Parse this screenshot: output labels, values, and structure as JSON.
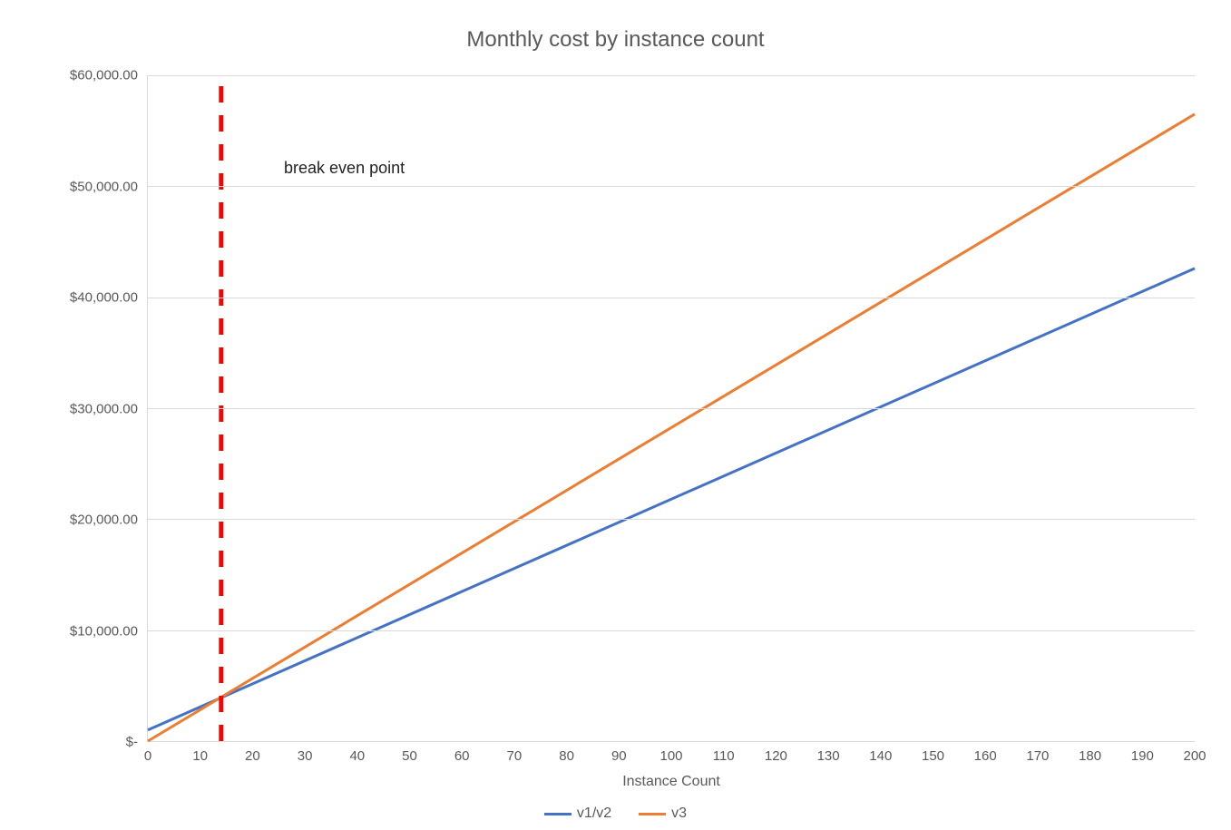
{
  "chart_data": {
    "type": "line",
    "title": "Monthly cost by instance count",
    "xlabel": "Instance Count",
    "ylabel": "",
    "xlim": [
      0,
      200
    ],
    "ylim": [
      0,
      60000
    ],
    "x_ticks": [
      0,
      10,
      20,
      30,
      40,
      50,
      60,
      70,
      80,
      90,
      100,
      110,
      120,
      130,
      140,
      150,
      160,
      170,
      180,
      190,
      200
    ],
    "y_ticks": [
      0,
      10000,
      20000,
      30000,
      40000,
      50000,
      60000
    ],
    "y_tick_labels": [
      " $-  ",
      " $10,000.00 ",
      " $20,000.00 ",
      " $30,000.00 ",
      " $40,000.00 ",
      " $50,000.00 ",
      " $60,000.00 "
    ],
    "series": [
      {
        "name": "v1/v2",
        "color": "#4472C4",
        "x": [
          0,
          200
        ],
        "y": [
          1000,
          42600
        ]
      },
      {
        "name": "v3",
        "color": "#ED7D31",
        "x": [
          0,
          200
        ],
        "y": [
          0,
          56500
        ]
      }
    ],
    "reference_line": {
      "x": 14,
      "color": "#FF0000",
      "dash": true
    },
    "annotation": {
      "text": "break even point",
      "x": 26,
      "y": 52500
    }
  }
}
